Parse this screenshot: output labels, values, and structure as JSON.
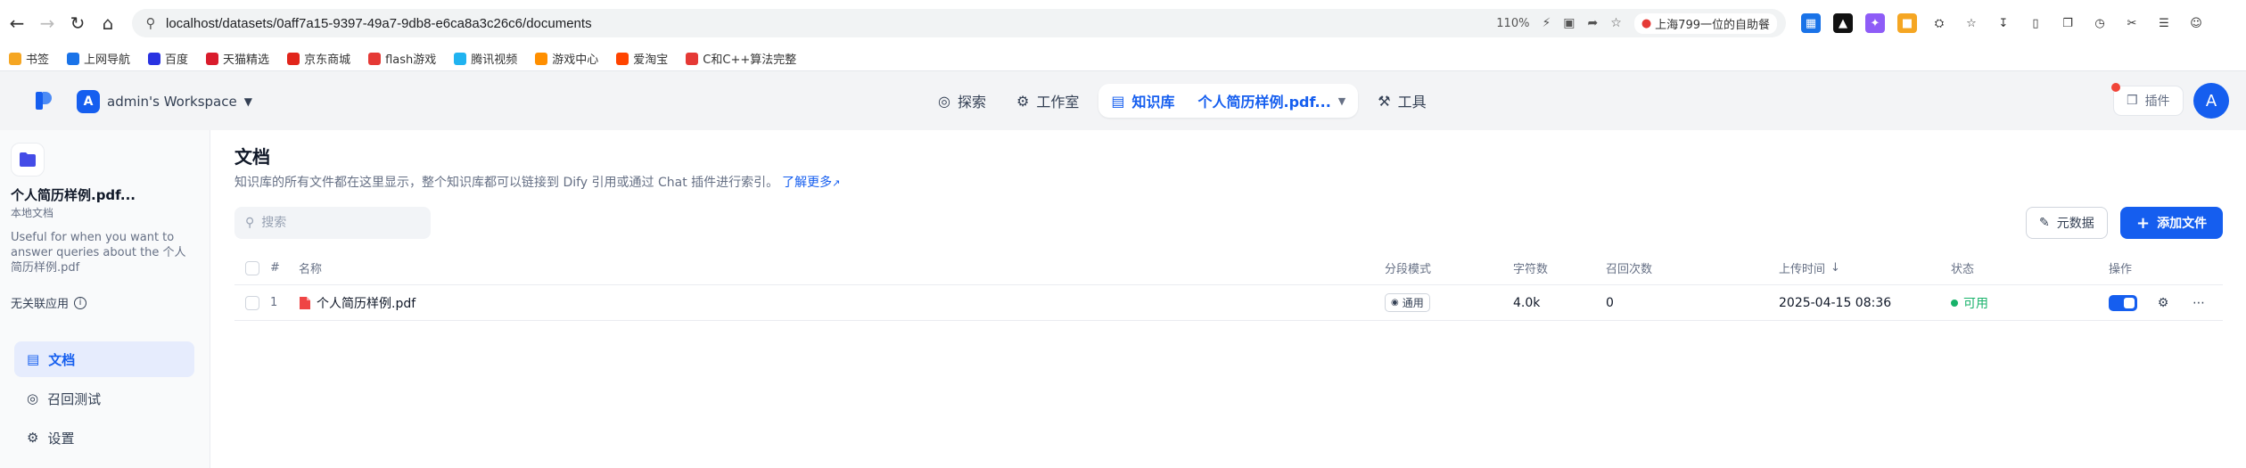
{
  "browser": {
    "url": "localhost/datasets/0aff7a15-9397-49a7-9db8-e6ca8a3c26c6/documents",
    "zoom": "110%",
    "news_tag": "上海799一位的自助餐",
    "bookmarks": [
      {
        "label": "书签",
        "color": "#f5a623"
      },
      {
        "label": "上网导航",
        "color": "#1a73e8"
      },
      {
        "label": "百度",
        "color": "#2932e1"
      },
      {
        "label": "天猫精选",
        "color": "#d91c2c"
      },
      {
        "label": "京东商城",
        "color": "#e1251b"
      },
      {
        "label": "flash游戏",
        "color": "#e53935"
      },
      {
        "label": "腾讯视频",
        "color": "#20b3f0"
      },
      {
        "label": "游戏中心",
        "color": "#ff8f00"
      },
      {
        "label": "爱淘宝",
        "color": "#ff4400"
      },
      {
        "label": "C和C++算法完整",
        "color": "#e53935"
      }
    ]
  },
  "header": {
    "workspace_initial": "A",
    "workspace_name": "admin's Workspace",
    "nav": {
      "explore": "探索",
      "studio": "工作室",
      "knowledge": "知识库",
      "knowledge_current": "个人简历样例.pdf...",
      "tools": "工具"
    },
    "plugin_label": "插件",
    "user_initial": "A"
  },
  "sidebar": {
    "dataset_name": "个人简历样例.pdf...",
    "dataset_type": "本地文档",
    "description": "Useful for when you want to answer queries about the 个人简历样例.pdf",
    "association": "无关联应用",
    "menu": {
      "documents": "文档",
      "retrieval_test": "召回测试",
      "settings": "设置"
    }
  },
  "main": {
    "title": "文档",
    "description": "知识库的所有文件都在这里显示，整个知识库都可以链接到 Dify 引用或通过 Chat 插件进行索引。",
    "learn_more": "了解更多",
    "search_placeholder": "搜索",
    "metadata_button": "元数据",
    "add_file_button": "添加文件",
    "columns": {
      "index": "#",
      "name": "名称",
      "chunk_mode": "分段模式",
      "chars": "字符数",
      "hit_count": "召回次数",
      "upload_time": "上传时间",
      "status": "状态",
      "actions": "操作"
    },
    "rows": [
      {
        "index": "1",
        "name": "个人简历样例.pdf",
        "chunk_mode": "通用",
        "chars": "4.0k",
        "hit_count": "0",
        "upload_time": "2025-04-15 08:36",
        "status": "可用"
      }
    ]
  },
  "colors": {
    "primary": "#155eef",
    "success": "#17b26a",
    "pdf": "#ef4444"
  }
}
